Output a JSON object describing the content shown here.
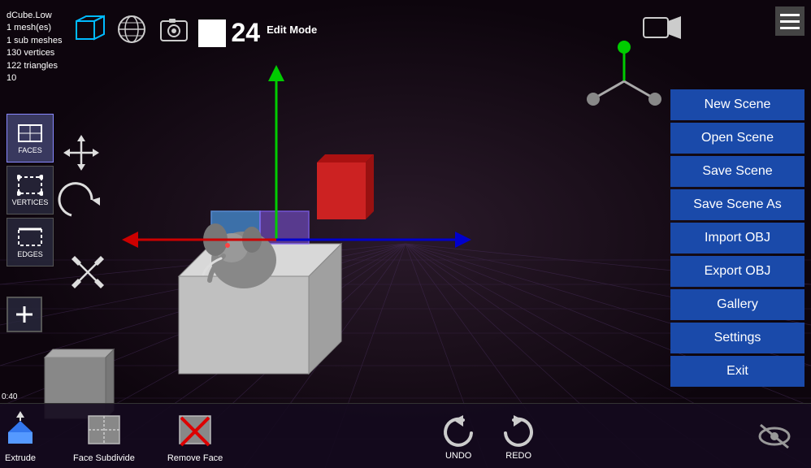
{
  "info": {
    "object_name": "dCube.Low",
    "mesh_count": "1 mesh(es)",
    "sub_meshes": "1 sub meshes",
    "vertices": "130 vertices",
    "triangles": "122 triangles",
    "number": "10"
  },
  "mode": {
    "label": "Edit Mode"
  },
  "frame": {
    "number": "24"
  },
  "coord": {
    "value": "0:40"
  },
  "left_tools": [
    {
      "id": "faces",
      "label": "FACES"
    },
    {
      "id": "vertices",
      "label": "VERTICES"
    },
    {
      "id": "edges",
      "label": "EDGES"
    }
  ],
  "right_menu": {
    "buttons": [
      {
        "id": "new-scene",
        "label": "New Scene"
      },
      {
        "id": "open-scene",
        "label": "Open Scene"
      },
      {
        "id": "save-scene",
        "label": "Save Scene"
      },
      {
        "id": "save-scene-as",
        "label": "Save Scene As"
      },
      {
        "id": "import-obj",
        "label": "Import OBJ"
      },
      {
        "id": "export-obj",
        "label": "Export OBJ"
      },
      {
        "id": "gallery",
        "label": "Gallery"
      },
      {
        "id": "settings",
        "label": "Settings"
      },
      {
        "id": "exit",
        "label": "Exit"
      }
    ]
  },
  "bottom_tools": [
    {
      "id": "extrude",
      "label": "Extrude"
    },
    {
      "id": "face-subdivide",
      "label": "Face Subdivide"
    },
    {
      "id": "remove-face",
      "label": "Remove Face"
    }
  ],
  "undo": {
    "label": "UNDO"
  },
  "redo": {
    "label": "REDO"
  },
  "icons": {
    "hamburger": "☰",
    "globe": "🌐",
    "camera_top": "🎥",
    "faces_icon": "▣",
    "vertices_icon": "⬡",
    "edges_icon": "⬟",
    "undo_arrow": "↺",
    "redo_arrow": "↻",
    "eye_slash": "👁",
    "plus": "+"
  }
}
